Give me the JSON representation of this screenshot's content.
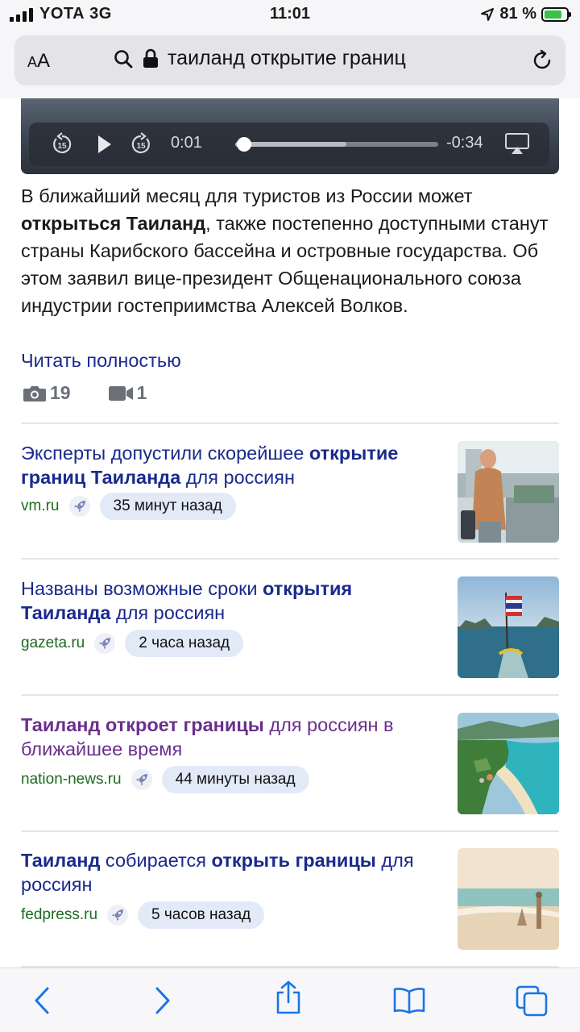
{
  "status_bar": {
    "carrier": "YOTA",
    "network": "3G",
    "time": "11:01",
    "battery": "81 %",
    "battery_level": 0.81
  },
  "browser": {
    "text_size_label": "AA",
    "query": "таиланд открытие границ"
  },
  "video": {
    "elapsed": "0:01",
    "remaining": "-0:34",
    "skip_back_label": "15",
    "skip_forward_label": "15"
  },
  "article": {
    "lead_1": "В ближайший месяц для туристов из России может ",
    "lead_bold": "открыться Таиланд",
    "lead_2": ", также постепенно доступными станут страны Карибского бассейна и островные государства. Об этом заявил вице-президент Общенационального союза индустрии гостеприимства Алексей Волков.",
    "read_more": "Читать полностью",
    "photo_count": "19",
    "video_count": "1"
  },
  "news": [
    {
      "title_1": "Эксперты допустили скорейшее ",
      "title_bold": "открытие границ Таиланда",
      "title_2": " для россиян",
      "source": "vm.ru",
      "time": "35 минут назад"
    },
    {
      "title_1": "Названы возможные сроки ",
      "title_bold": "открытия Таиланда",
      "title_2": " для россиян",
      "source": "gazeta.ru",
      "time": "2 часа назад"
    },
    {
      "title_bold_1": "Таиланд откроет границы",
      "title_2": " для россиян в ближайшее время",
      "source": "nation-news.ru",
      "time": "44 минуты назад"
    },
    {
      "title_bold_1": "Таиланд",
      "title_2": " собирается ",
      "title_bold_2": "открыть границы",
      "title_3": " для россиян",
      "source": "fedpress.ru",
      "time": "5 часов назад"
    }
  ],
  "colors": {
    "link": "#1a2a8c",
    "visited": "#6a2f8c",
    "source": "#1f6b1f",
    "ios_blue": "#1a74e8"
  }
}
